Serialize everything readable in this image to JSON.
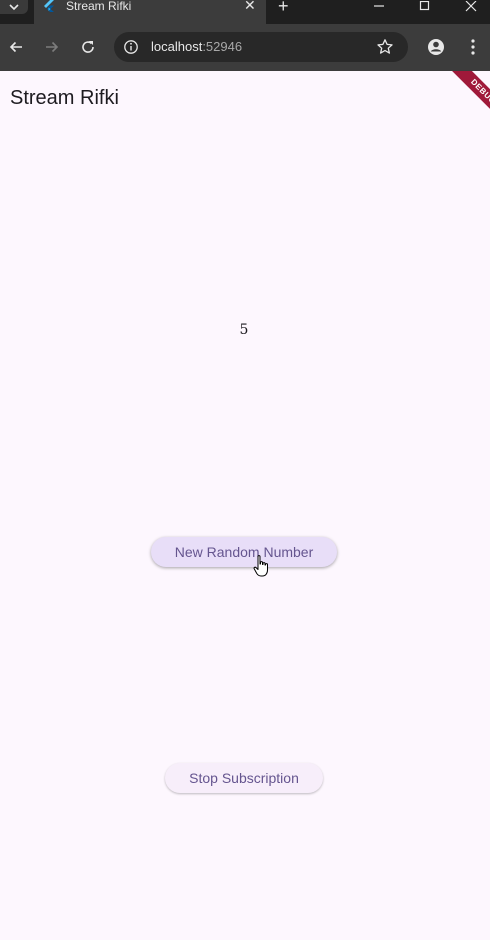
{
  "browser": {
    "tab": {
      "title": "Stream Rifki",
      "favicon": "flutter-icon",
      "close_glyph": "✕"
    },
    "new_tab_glyph": "+",
    "window_controls": [
      "minimize-icon",
      "maximize-icon",
      "close-icon"
    ],
    "address_bar": {
      "host": "localhost",
      "port": ":52946"
    },
    "colors": {
      "tabstrip": "#1f1f1f",
      "toolbar": "#3c3c3c",
      "omnibox": "#282828"
    }
  },
  "app": {
    "title": "Stream Rifki",
    "debug_banner": "DEBUG",
    "number_value": "5",
    "buttons": {
      "new_random": "New Random Number",
      "stop": "Stop Subscription"
    },
    "colors": {
      "background": "#fdf7fe",
      "button_primary_bg": "#e8def8",
      "button_text": "#65558f",
      "debug_ribbon": "#a0193a"
    }
  }
}
